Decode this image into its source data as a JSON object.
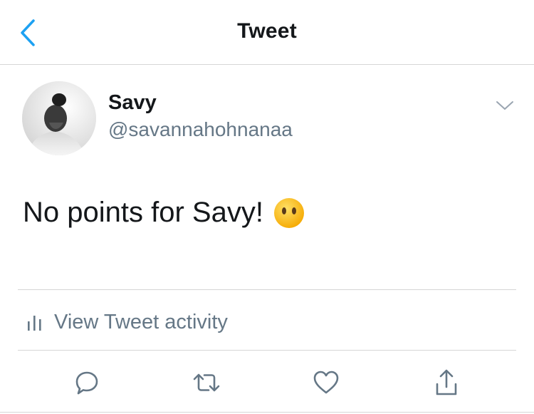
{
  "header": {
    "title": "Tweet",
    "back_icon": "chevron-left-icon"
  },
  "tweet": {
    "author_name": "Savy",
    "author_handle": "@savannahohnanaa",
    "text": "No points for Savy!",
    "emoji": "face-without-mouth-emoji"
  },
  "activity": {
    "label": "View Tweet activity",
    "icon": "bar-chart-icon"
  },
  "actions": {
    "reply": "reply-icon",
    "retweet": "retweet-icon",
    "like": "heart-icon",
    "share": "share-icon"
  },
  "colors": {
    "accent": "#1da1f2",
    "secondary_text": "#657786",
    "divider": "#d6d6d6"
  }
}
